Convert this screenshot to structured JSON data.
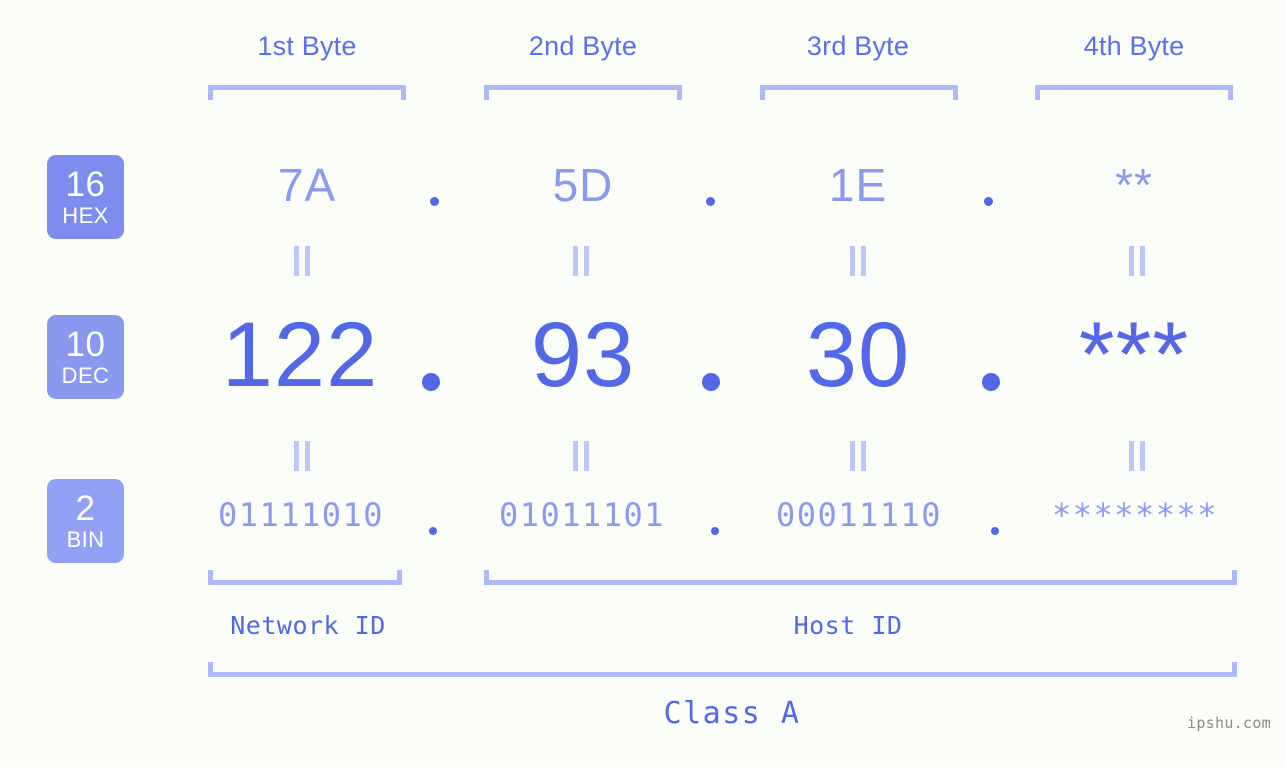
{
  "theme": {
    "background": "#fbfdf8",
    "accent_strong": "#5268e6",
    "accent_mid": "#8b9af0",
    "accent_light": "#aeb9f7",
    "badge_hex": "#7d8ced",
    "badge_dec": "#8b98f0",
    "badge_bin": "#93a1f4",
    "watermark_color": "#8a8a8a"
  },
  "columns": [
    {
      "header": "1st Byte"
    },
    {
      "header": "2nd Byte"
    },
    {
      "header": "3rd Byte"
    },
    {
      "header": "4th Byte"
    }
  ],
  "rows": {
    "hex": {
      "badge_num": "16",
      "badge_abbr": "HEX",
      "values": [
        "7A",
        "5D",
        "1E",
        "**"
      ]
    },
    "dec": {
      "badge_num": "10",
      "badge_abbr": "DEC",
      "values": [
        "122",
        "93",
        "30",
        "***"
      ]
    },
    "bin": {
      "badge_num": "2",
      "badge_abbr": "BIN",
      "values": [
        "01111010",
        "01011101",
        "00011110",
        "********"
      ]
    }
  },
  "separators": {
    "dot": ".",
    "equals": "="
  },
  "sections": {
    "network_id": "Network ID",
    "host_id": "Host ID",
    "class": "Class A"
  },
  "footer": {
    "watermark": "ipshu.com"
  }
}
